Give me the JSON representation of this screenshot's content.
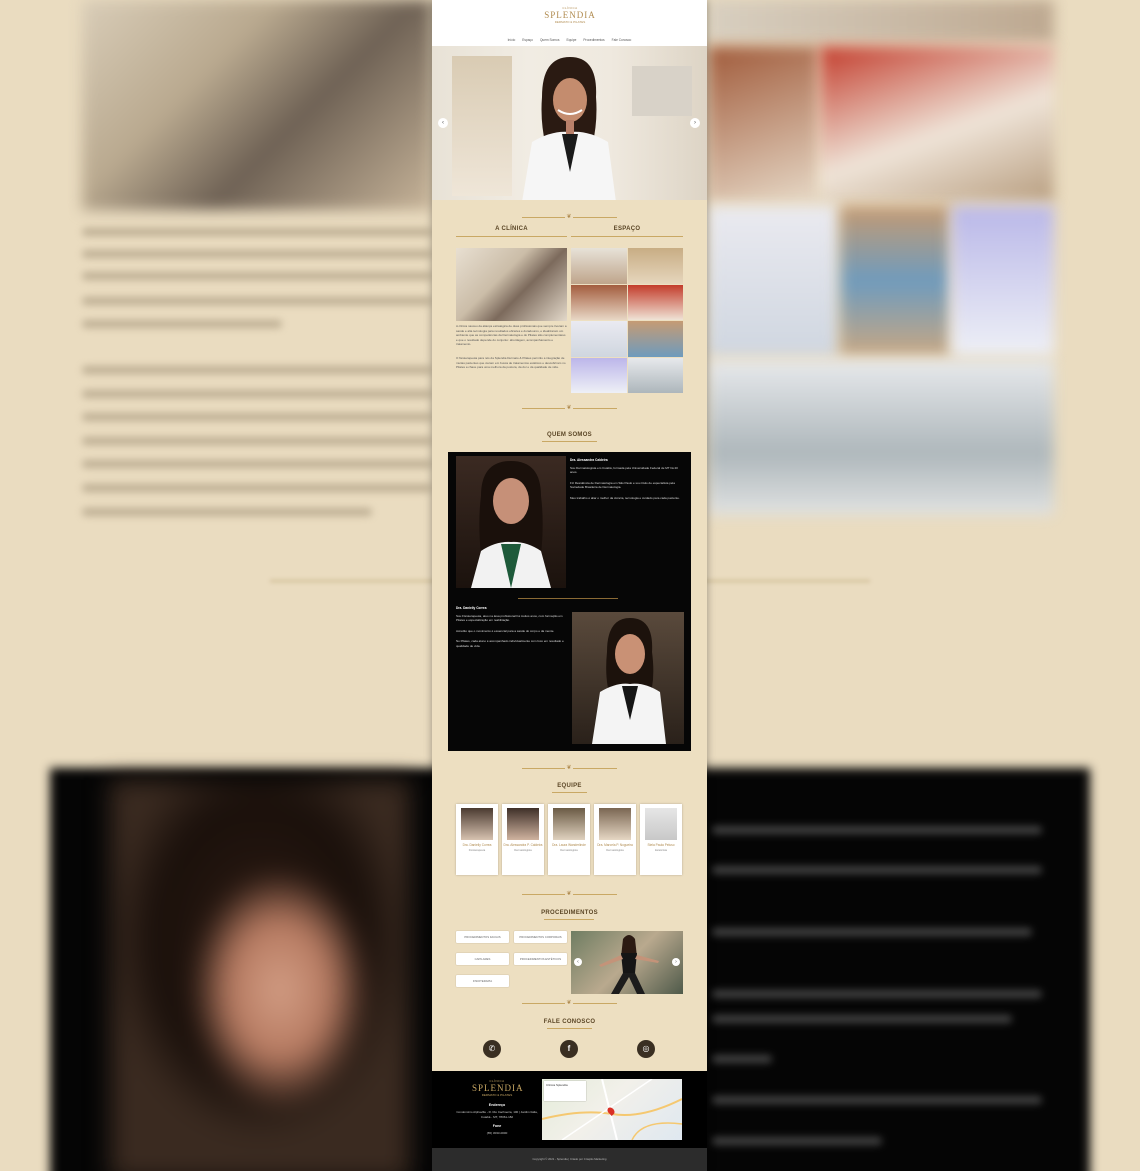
{
  "brand": {
    "top": "CLÍNICA",
    "name": "SPLENDIA",
    "tagline": "DERMATO & PILATES"
  },
  "nav": [
    "Início",
    "Espaço",
    "Quem Somos",
    "Equipe",
    "Procedimentos",
    "Fale Conosco"
  ],
  "sections": {
    "clinic": "A CLÍNICA",
    "space": "ESPAÇO",
    "about": "QUEM SOMOS",
    "team": "EQUIPE",
    "procedures": "PROCEDIMENTOS",
    "contact": "FALE CONOSCO"
  },
  "clinic_text": [
    "A clínica nasceu da aliança estratégica de duas profissionais que sempre tiveram a saúde e alta tecnologia para resultados eficazes e duradouros, e idealizaram um ambiente que as competências da Dermatologia e do Pilates são complementares e que o resultado depende do conjunto: abordagem, acompanhamento e tratamento.",
    "O fisioterapeuta para nós da Splendia Dermato & Pilates permitiu a integração de muitas pacientes que vieram em busca de tratamentos estéticos e descobriram no Pilates a chave para uma melhora da postura, da dor e da qualidade de vida."
  ],
  "doctors": [
    {
      "name": "Dra. Alessandra Caldeira",
      "bio": [
        "Sou Dermatologista em Cuiabá, formada pela Universidade Federal de MT há 20 anos.",
        "Fiz Residência de Dermatologia em São Paulo e sou título de especialista pela Sociedade Brasileira de Dermatologia.",
        "Meu trabalho é aliar o melhor da ciência, tecnologia e cuidado para cada paciente."
      ]
    },
    {
      "name": "Dra. Danielly Correa",
      "bio": [
        "Sou Fisioterapeuta, atuo na área profissional há muitos anos, com formação em Pilates e especialização em reabilitação.",
        "Acredito que o movimento é essencial para a saúde do corpo e da mente.",
        "No Pilates, cada aluno é acompanhado individualmente com foco em resultado e qualidade de vida."
      ]
    }
  ],
  "team": [
    {
      "name": "Dra. Danielly Correa",
      "role": "Fisioterapeuta",
      "bg": "#4a3a30"
    },
    {
      "name": "Dra. Alessandra P. Caldeira",
      "role": "Dermatologista",
      "bg": "#3e2f28"
    },
    {
      "name": "Dra. Laura Wanderlinde",
      "role": "Dermatologista",
      "bg": "#6a5a44"
    },
    {
      "name": "Dra. Marcela P. Nogueira",
      "role": "Dermatologista",
      "bg": "#7a6652"
    },
    {
      "name": "Stela Paula Peluso",
      "role": "Esteticista",
      "bg": "#e6e6e6"
    }
  ],
  "procedures": [
    "PROCEDIMENTOS FACIAIS",
    "PROCEDIMENTOS CORPORAIS",
    "CAPILARES",
    "PROCEDIMENTOS ESTÉTICOS",
    "FISIOTERAPIA"
  ],
  "footer": {
    "address_label": "Endereço",
    "address": "Condomínio Alphaville - R. Rio Cachoeira, 100 | Jardim Itália, Cuiabá - MT, 78061-182",
    "phone_label": "Fone",
    "phone": "(65) 3033-0000",
    "map_label": "Clínica Splendia"
  },
  "copyright": "Copyright © 2021 - Splendia | Criado por Criação Marketing",
  "colors": {
    "gold": "#b08b4f",
    "beige": "#eddfc1",
    "dark": "#060606"
  }
}
